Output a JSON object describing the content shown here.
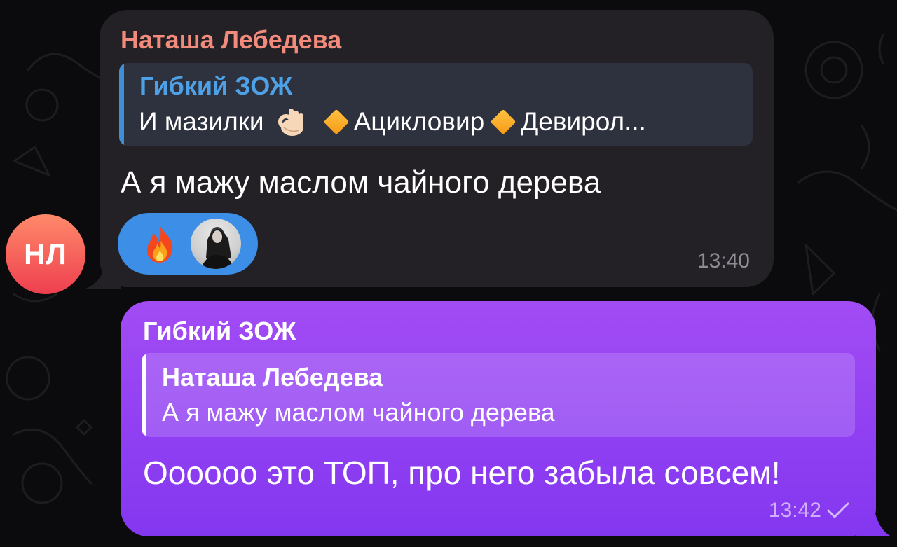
{
  "incoming": {
    "sender": "Наташа Лебедева",
    "reply": {
      "title": "Гибкий ЗОЖ",
      "text_start": "И мазилки",
      "item1": "Ацикловир",
      "item2": "Девирол..."
    },
    "message": "А я мажу маслом чайного дерева",
    "reactions": [
      {
        "icon": "fire-emoji"
      }
    ],
    "time": "13:40"
  },
  "avatar": {
    "initials": "НЛ",
    "color": "#ee3f4f"
  },
  "outgoing": {
    "sender": "Гибкий ЗОЖ",
    "reply": {
      "title": "Наташа Лебедева",
      "text": "А я мажу маслом чайного дерева"
    },
    "message": "Оооооо это ТОП, про него забыла совсем!",
    "time": "13:42",
    "status": "sent-check-icon"
  },
  "colors": {
    "incoming_bubble": "#242126",
    "outgoing_bubble": "#9040f2",
    "sender_name": "#f28b7c",
    "reply_accent": "#3f8fd8",
    "reaction_pill": "#3d8ee6"
  }
}
